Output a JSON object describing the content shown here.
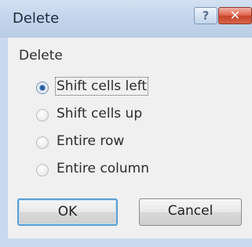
{
  "window": {
    "title": "Delete",
    "help_glyph": "?",
    "close_glyph": "✕"
  },
  "group": {
    "label": "Delete",
    "options": [
      {
        "label": "Shift cells left",
        "selected": true
      },
      {
        "label": "Shift cells up",
        "selected": false
      },
      {
        "label": "Entire row",
        "selected": false
      },
      {
        "label": "Entire column",
        "selected": false
      }
    ]
  },
  "buttons": {
    "ok_label": "OK",
    "cancel_label": "Cancel"
  },
  "colors": {
    "titlebar": "#c4d6ec",
    "close_button": "#d4543a",
    "default_button_border": "#5c9fd2",
    "radio_selected": "#2a5ea6"
  }
}
